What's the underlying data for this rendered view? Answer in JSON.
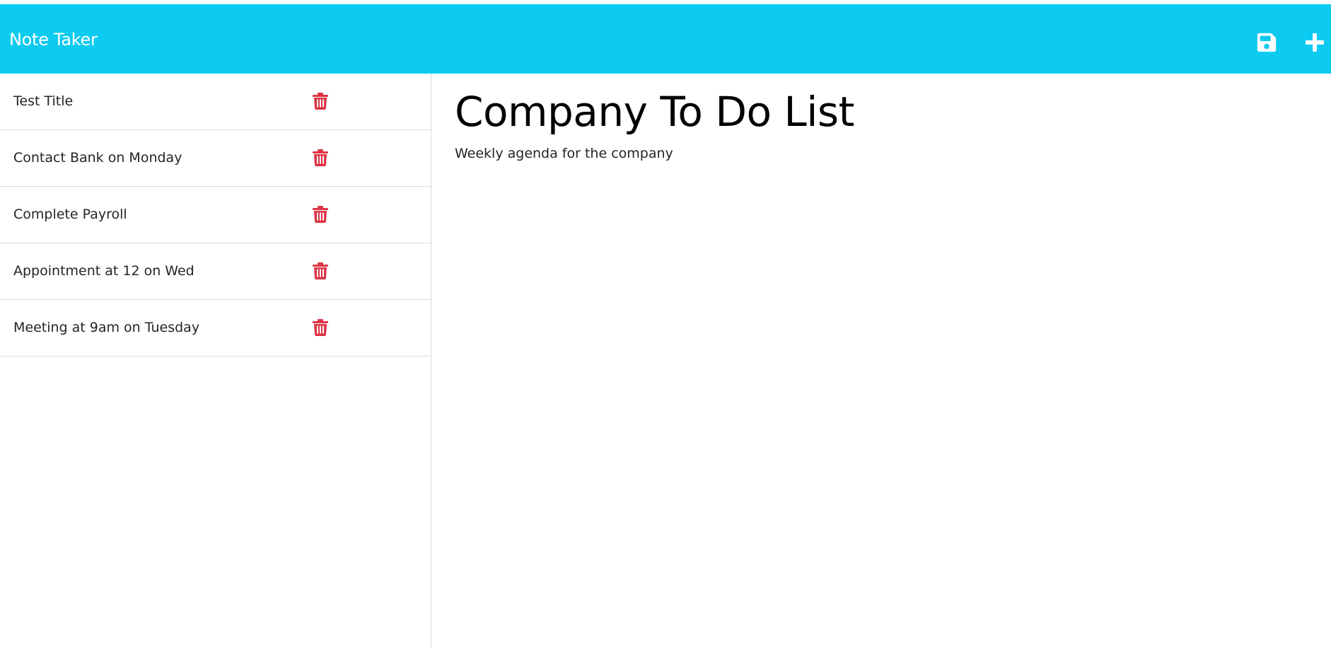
{
  "app": {
    "brand": "Note Taker",
    "navbar_color": "#0dcaf0",
    "actions": [
      {
        "name": "save-note",
        "icon": "save-icon"
      },
      {
        "name": "new-note",
        "icon": "plus-icon"
      }
    ]
  },
  "sidebar": {
    "delete_icon": "trash-icon",
    "delete_color": "#dc3545",
    "notes": [
      {
        "title": "Test Title"
      },
      {
        "title": "Contact Bank on Monday"
      },
      {
        "title": "Complete Payroll"
      },
      {
        "title": "Appointment at 12 on Wed"
      },
      {
        "title": "Meeting at 9am on Tuesday"
      }
    ]
  },
  "editor": {
    "title": "Company To Do List",
    "body": "Weekly agenda for the company"
  }
}
